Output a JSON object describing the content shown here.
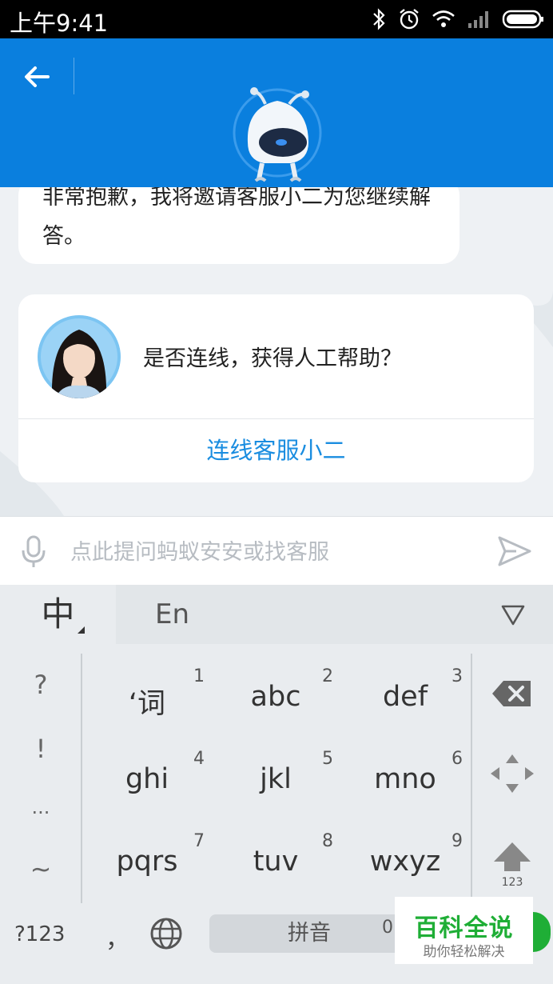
{
  "status_bar": {
    "time": "上午9:41"
  },
  "chat": {
    "bot_message": "非常抱歉，我将邀请客服小二为您继续解答。",
    "card": {
      "question": "是否连线，获得人工帮助？",
      "action_label": "连线客服小二"
    }
  },
  "input": {
    "placeholder": "点此提问蚂蚁安安或找客服"
  },
  "keyboard": {
    "tab_zh": "中",
    "tab_en": "En",
    "side_keys": [
      "?",
      "!",
      "...",
      "~"
    ],
    "keys": [
      {
        "label": "‘词",
        "num": "1"
      },
      {
        "label": "abc",
        "num": "2"
      },
      {
        "label": "def",
        "num": "3"
      },
      {
        "label": "ghi",
        "num": "4"
      },
      {
        "label": "jkl",
        "num": "5"
      },
      {
        "label": "mno",
        "num": "6"
      },
      {
        "label": "pqrs",
        "num": "7"
      },
      {
        "label": "tuv",
        "num": "8"
      },
      {
        "label": "wxyz",
        "num": "9"
      }
    ],
    "shift_label": "123",
    "bottom": {
      "symbols": "?123",
      "comma": "，",
      "space": "拼音",
      "zero": "0"
    }
  },
  "watermark": {
    "main": "百科全说",
    "sub": "助你轻松解决"
  },
  "colors": {
    "header": "#0a7fde",
    "link": "#1a8de0",
    "watermark": "#1fae36"
  }
}
